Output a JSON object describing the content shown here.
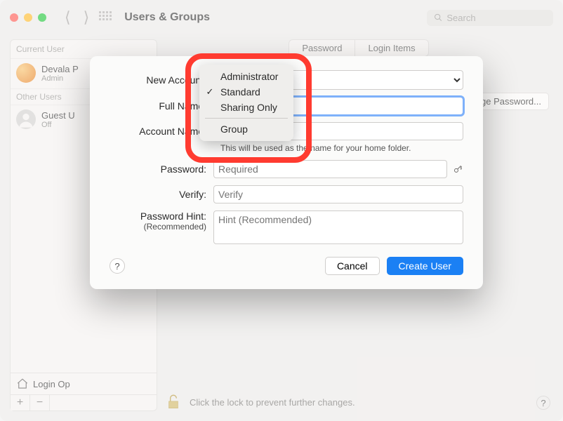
{
  "window": {
    "title": "Users & Groups"
  },
  "toolbar": {
    "search_placeholder": "Search"
  },
  "sidebar": {
    "current_header": "Current User",
    "other_header": "Other Users",
    "current": {
      "name": "Devala P",
      "role": "Admin"
    },
    "others": [
      {
        "name": "Guest U",
        "role": "Off"
      }
    ],
    "login_options": "Login Op"
  },
  "main": {
    "tabs": {
      "password": "Password",
      "login_items": "Login Items"
    },
    "change_password": "Change Password..."
  },
  "sheet": {
    "new_account_label": "New Account:",
    "full_name_label": "Full Name:",
    "account_name_label": "Account Name:",
    "account_name_hint": "This will be used as the name for your home folder.",
    "password_label": "Password:",
    "password_placeholder": "Required",
    "verify_label": "Verify:",
    "verify_placeholder": "Verify",
    "hint_label": "Password Hint:",
    "hint_sub": "(Recommended)",
    "hint_placeholder": "Hint (Recommended)",
    "cancel": "Cancel",
    "create": "Create User"
  },
  "dropdown": {
    "options": [
      "Administrator",
      "Standard",
      "Sharing Only",
      "Group"
    ],
    "selected": "Standard"
  },
  "lock_hint": "Click the lock to prevent further changes."
}
